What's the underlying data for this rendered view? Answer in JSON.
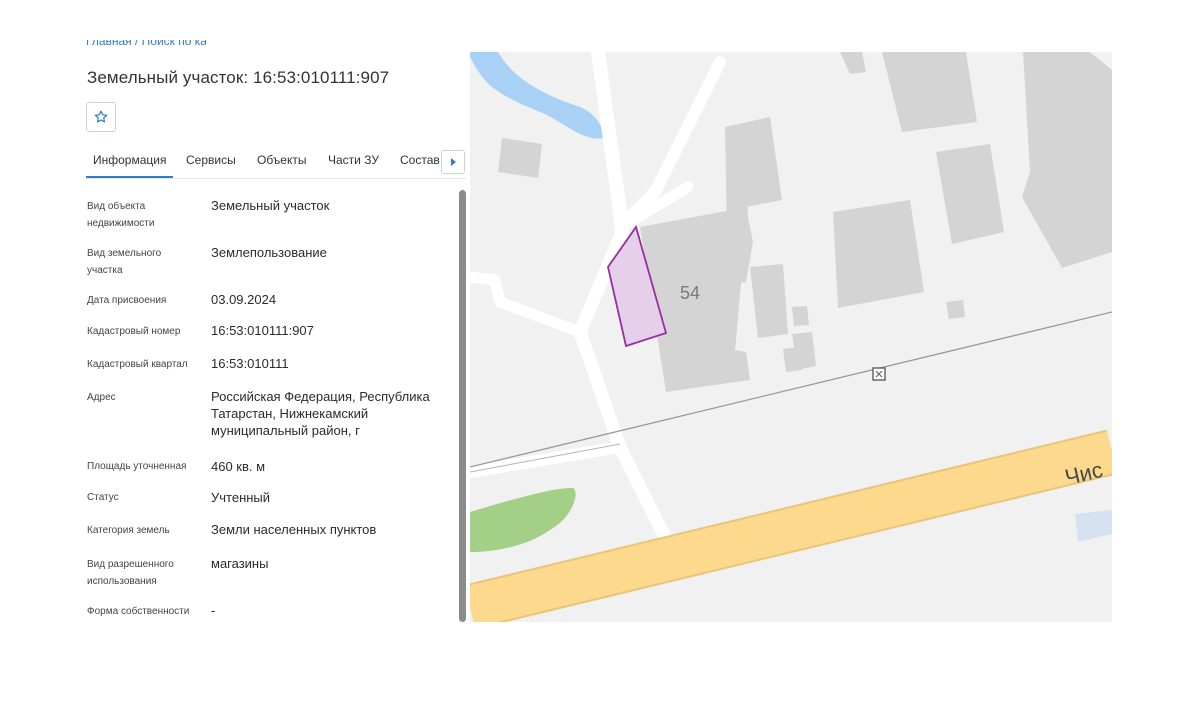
{
  "breadcrumb": {
    "text": "Главная / Поиск по кадастру / Данные"
  },
  "header": {
    "title": "Земельный участок: 16:53:010111:907"
  },
  "favorite": {
    "icon": "star-icon"
  },
  "tabs": [
    {
      "label": "Информация",
      "active": true
    },
    {
      "label": "Сервисы",
      "active": false
    },
    {
      "label": "Объекты",
      "active": false
    },
    {
      "label": "Части ЗУ",
      "active": false
    },
    {
      "label": "Состав",
      "active": false
    }
  ],
  "tabs_scroll": {
    "icon": "chevron-right-icon"
  },
  "properties": [
    {
      "label": "Вид объекта недвижимости",
      "value": "Земельный участок"
    },
    {
      "label": "Вид земельного участка",
      "value": "Землепользование"
    },
    {
      "label": "Дата присвоения",
      "value": "03.09.2024"
    },
    {
      "label": "Кадастровый номер",
      "value": "16:53:010111:907"
    },
    {
      "label": "Кадастровый квартал",
      "value": "16:53:010111"
    },
    {
      "label": "Адрес",
      "value": "Российская Федерация, Республика Татарстан, Нижнекамский муниципальный район, г"
    },
    {
      "label": "Площадь уточненная",
      "value": "460 кв. м"
    },
    {
      "label": "Статус",
      "value": "Учтенный"
    },
    {
      "label": "Категория земель",
      "value": "Земли населенных пунктов"
    },
    {
      "label": "Вид разрешенного использования",
      "value": "магазины"
    },
    {
      "label": "Форма собственности",
      "value": "-"
    }
  ],
  "map": {
    "building_number": "54",
    "street_label": "Чис",
    "colors": {
      "background": "#f1f1f1",
      "building": "#d4d4d4",
      "road_main": "#fcd98c",
      "road_local": "#ffffff",
      "water": "#a8d1f5",
      "park": "#a3cf86",
      "parcel_fill": "#e6cfea",
      "parcel_stroke": "#9a2ea0"
    }
  },
  "colors": {
    "accent": "#2f7cc7"
  }
}
